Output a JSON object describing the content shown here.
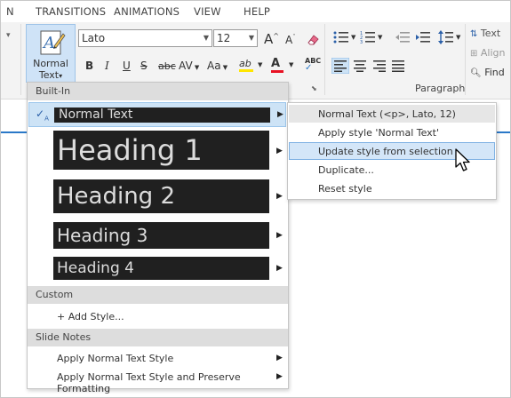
{
  "tabs": [
    "N",
    "TRANSITIONS",
    "ANIMATIONS",
    "VIEW",
    "HELP"
  ],
  "ribbon": {
    "normal_text_button": {
      "line1": "Normal",
      "line2": "Text",
      "dropdown_glyph": "▾"
    },
    "font": {
      "value": "Lato"
    },
    "font_size": {
      "value": "12"
    },
    "format_buttons": {
      "bold": "B",
      "italic": "I",
      "underline": "U",
      "strikethrough": "S",
      "small_caps": "abc",
      "char_spacing": "AV",
      "change_case": "Aa",
      "highlight": "ab",
      "font_color": "A",
      "spelling": "ABC"
    },
    "paragraph_group_label": "Paragraph",
    "text_label": "Text",
    "align_label": "Align",
    "find_label": "Find"
  },
  "menu": {
    "builtin_header": "Built-In",
    "styles": [
      {
        "label": "Normal Text",
        "checked": true
      },
      {
        "label": "Heading 1"
      },
      {
        "label": "Heading 2"
      },
      {
        "label": "Heading 3"
      },
      {
        "label": "Heading 4"
      }
    ],
    "custom_header": "Custom",
    "add_style": "+ Add Style...",
    "slide_notes_header": "Slide Notes",
    "slide_notes_items": [
      "Apply Normal Text Style",
      "Apply Normal Text Style and Preserve Formatting"
    ]
  },
  "submenu": {
    "items": [
      "Normal Text (<p>, Lato, 12)",
      "Apply style 'Normal Text'",
      "Update style from selection",
      "Duplicate...",
      "Reset style"
    ],
    "hovered": "Update style from selection"
  },
  "icons": [
    "normal-text-style-icon",
    "clear-format-icon",
    "bullets-icon",
    "numbering-icon",
    "decrease-indent-icon",
    "increase-indent-icon",
    "line-spacing-icon",
    "align-left-icon",
    "align-center-icon",
    "align-right-icon",
    "justify-icon",
    "text-direction-icon",
    "align-text-icon",
    "find-icon",
    "mouse-cursor-icon",
    "checkmark-icon",
    "submenu-arrow-icon"
  ],
  "colors": {
    "selection_blue": "#cde3f6",
    "accent_blue": "#2a78c8",
    "style_swatch_bg": "#202020",
    "highlight_yellow": "#ffe600",
    "font_color_red": "#e81123",
    "section_gray": "#dddddd"
  }
}
